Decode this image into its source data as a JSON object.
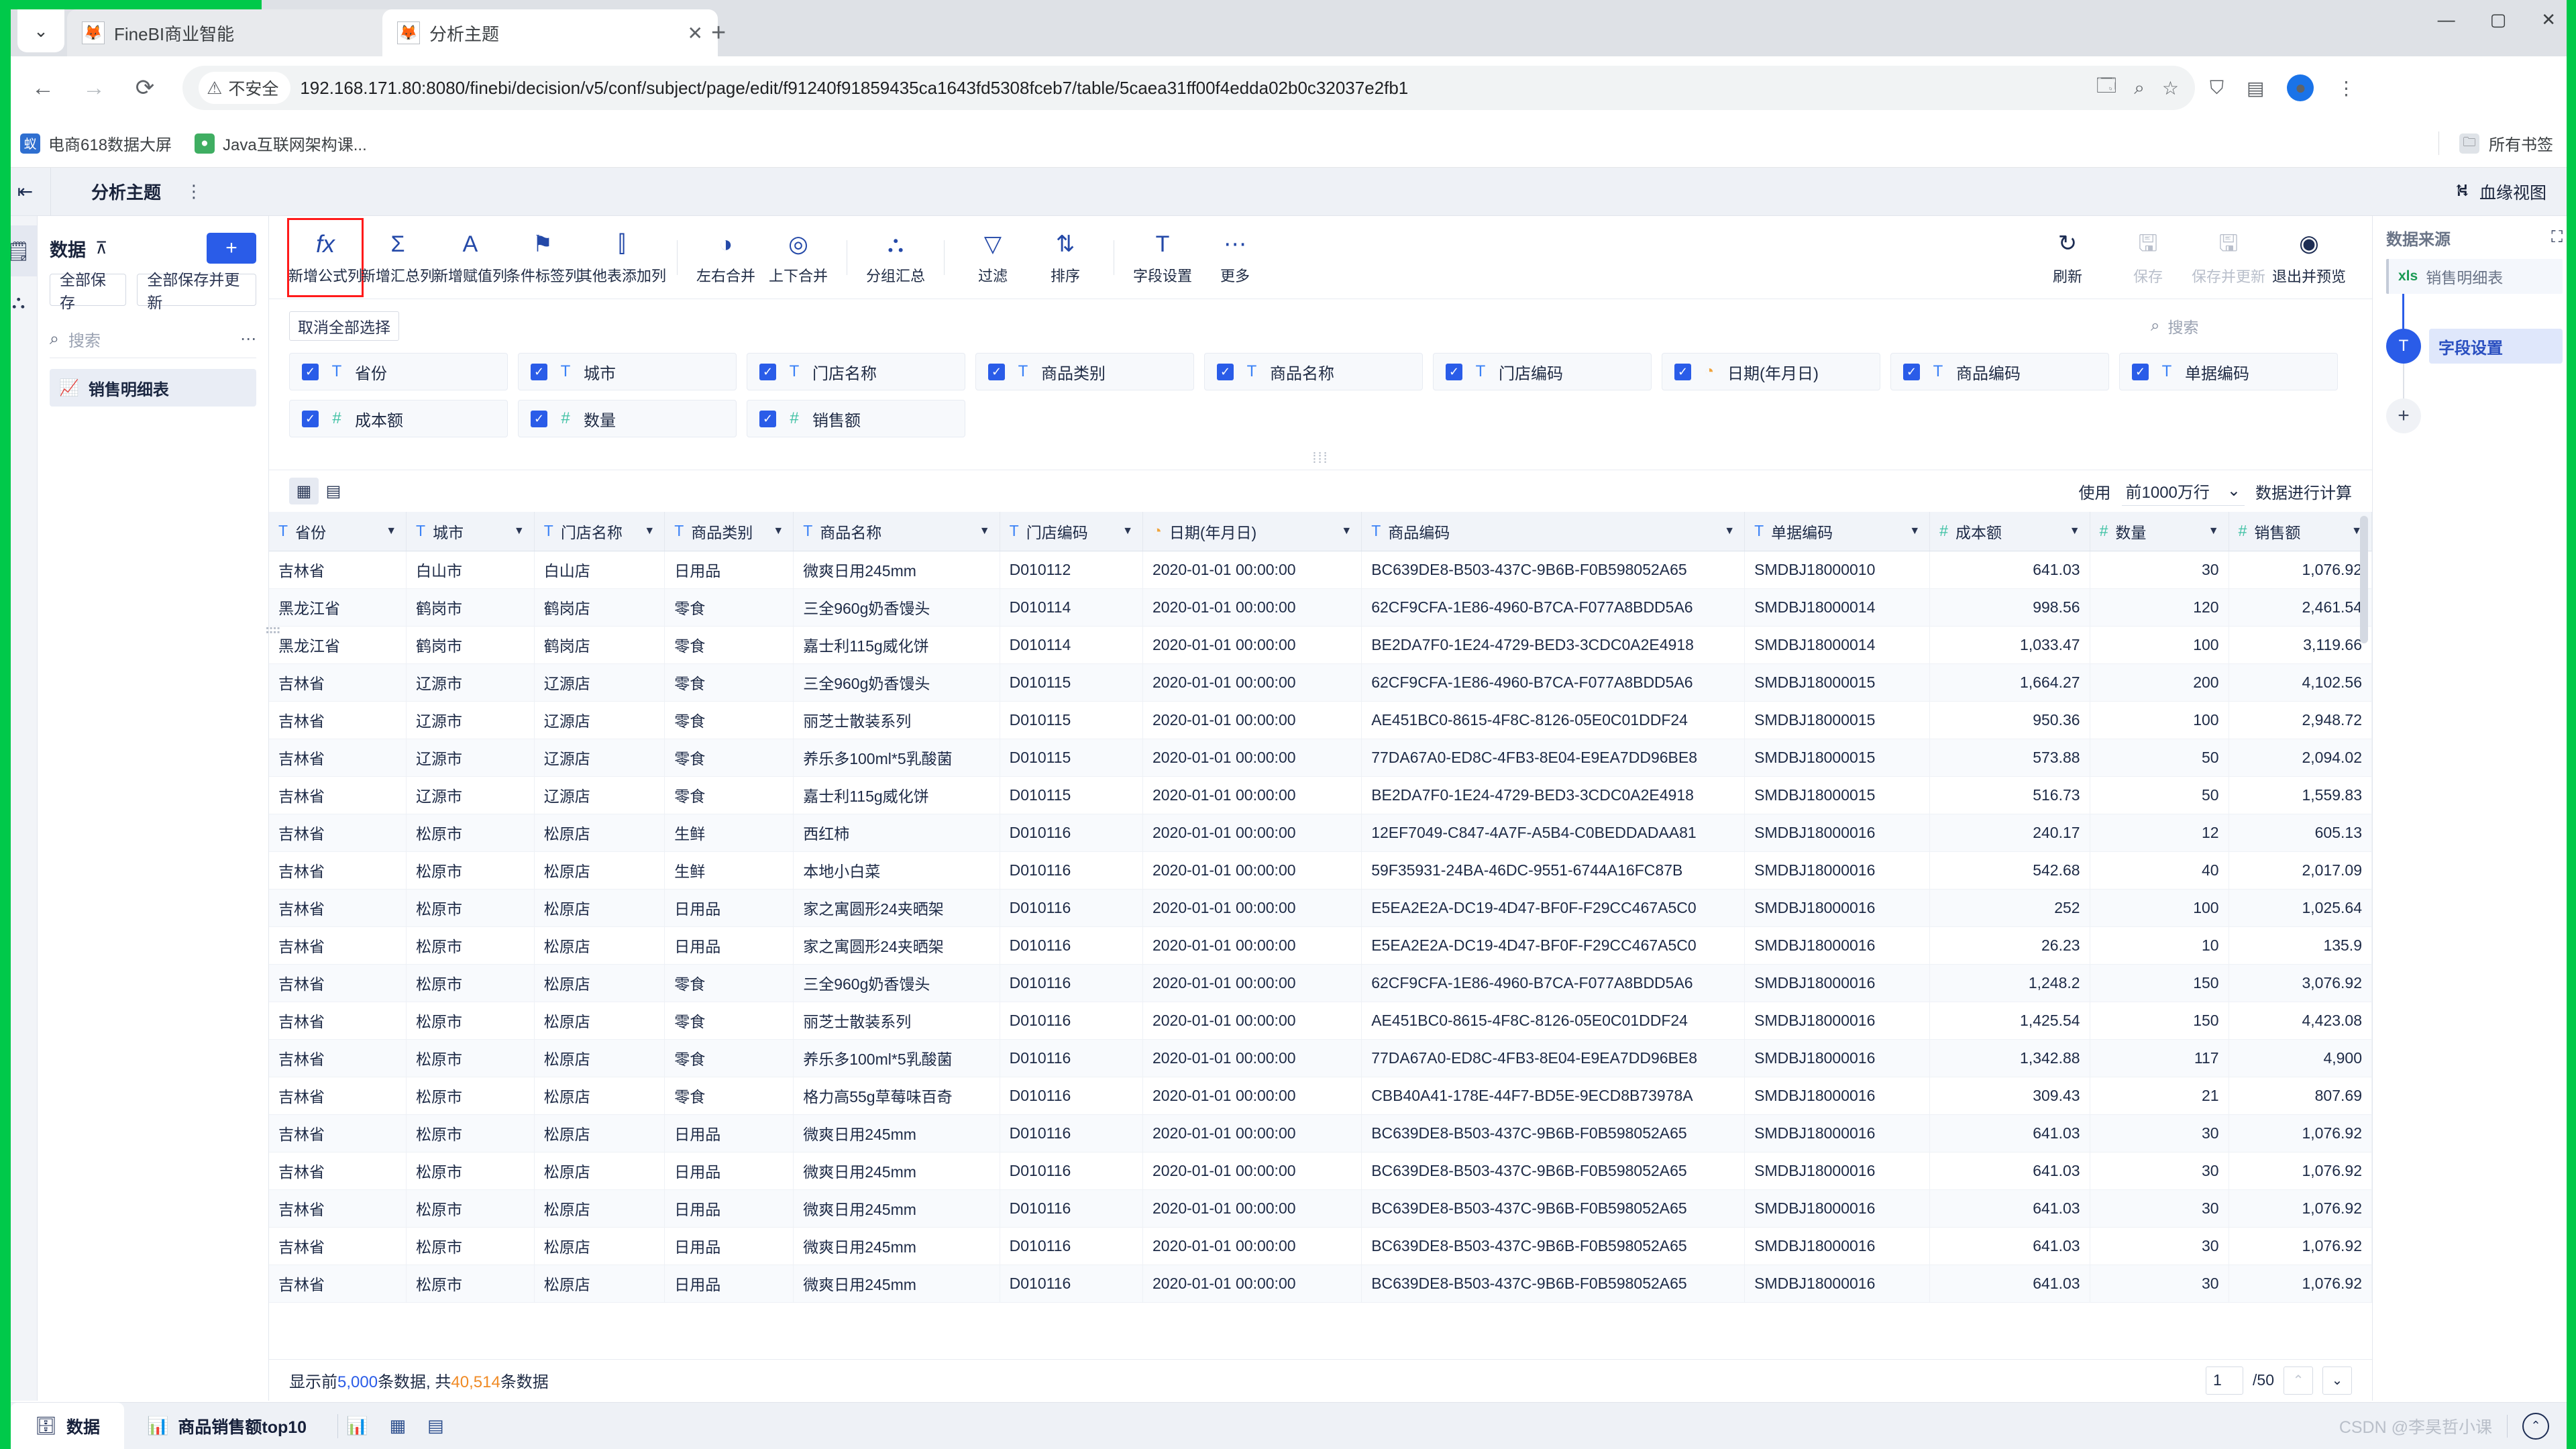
{
  "browser": {
    "tabs": [
      {
        "title": "FineBI商业智能",
        "active": false,
        "favicon": "🦊"
      },
      {
        "title": "分析主题",
        "active": true,
        "favicon": "🦊"
      }
    ],
    "new_tab_label": "+",
    "window_buttons": [
      "—",
      "▢",
      "✕"
    ],
    "nav": {
      "back": "←",
      "forward": "→",
      "reload": "⟳",
      "insecure_warning": "⚠",
      "insecure_label": "不安全",
      "url": "192.168.171.80:8080/finebi/decision/v5/conf/subject/page/edit/f91240f91859435ca1643fd5308fceb7/table/5caea31ff00f4edda02b0c32037e2fb1",
      "translate_icon": "🗔",
      "zoom_icon": "⌕",
      "star_icon": "☆",
      "extensions_icon": "⛉",
      "sidepanel_icon": "▤",
      "profile_initial": "●",
      "menu_icon": "⋮"
    },
    "bookmarks": [
      {
        "label": "电商618数据大屏",
        "color": "#2f6fd0",
        "glyph": "蚁"
      },
      {
        "label": "Java互联网架构课...",
        "color": "#3fae62",
        "glyph": "●"
      }
    ],
    "bookmarks_right": {
      "folder_icon": "🗀",
      "label": "所有书签"
    }
  },
  "app": {
    "header": {
      "back_icon": "⇤",
      "title": "分析主题",
      "more_icon": "⋮",
      "lineage_icon": "⛕",
      "lineage_label": "血缘视图"
    },
    "rail": [
      {
        "name": "analysis",
        "icon": "🗒",
        "active": true
      },
      {
        "name": "relation",
        "icon": "⛬",
        "active": false
      }
    ],
    "left_panel": {
      "title": "数据",
      "collapse_icon": "⌃",
      "add_label": "+",
      "save_all_label": "全部保存",
      "save_update_all_label": "全部保存并更新",
      "search_placeholder": "搜索",
      "search_icon": "⌕",
      "more_icon": "⋯",
      "items": [
        {
          "label": "销售明细表",
          "icon": "📈"
        }
      ]
    },
    "toolbar": {
      "items": [
        {
          "label": "新增公式列",
          "icon": "fx",
          "highlight": true
        },
        {
          "label": "新增汇总列",
          "icon": "Σ",
          "highlight": false
        },
        {
          "label": "新增赋值列",
          "icon": "A",
          "highlight": false
        },
        {
          "label": "条件标签列",
          "icon": "⚑",
          "highlight": false
        },
        {
          "label": "其他表添加列",
          "icon": "⫿",
          "highlight": false
        }
      ],
      "items2": [
        {
          "label": "左右合并",
          "icon": "◑"
        },
        {
          "label": "上下合并",
          "icon": "◎"
        }
      ],
      "items3": [
        {
          "label": "分组汇总",
          "icon": "⛬"
        }
      ],
      "items4": [
        {
          "label": "过滤",
          "icon": "▽"
        },
        {
          "label": "排序",
          "icon": "⇅"
        }
      ],
      "items5": [
        {
          "label": "字段设置",
          "icon": "T"
        }
      ],
      "items6": [
        {
          "label": "更多",
          "icon": "⋯"
        }
      ],
      "right_items": [
        {
          "label": "刷新",
          "icon": "↻",
          "disabled": false
        },
        {
          "label": "保存",
          "icon": "🖫",
          "disabled": true
        },
        {
          "label": "保存并更新",
          "icon": "🖫",
          "disabled": true
        },
        {
          "label": "退出并预览",
          "icon": "◉",
          "disabled": false
        }
      ]
    },
    "fields_area": {
      "clear_all_label": "取消全部选择",
      "search_placeholder": "搜索",
      "search_icon": "⌕",
      "chips": [
        {
          "label": "省份",
          "type": "T",
          "checked": true
        },
        {
          "label": "城市",
          "type": "T",
          "checked": true
        },
        {
          "label": "门店名称",
          "type": "T",
          "checked": true
        },
        {
          "label": "商品类别",
          "type": "T",
          "checked": true
        },
        {
          "label": "商品名称",
          "type": "T",
          "checked": true
        },
        {
          "label": "门店编码",
          "type": "T",
          "checked": true
        },
        {
          "label": "日期(年月日)",
          "type": "D",
          "checked": true
        },
        {
          "label": "商品编码",
          "type": "T",
          "checked": true
        },
        {
          "label": "单据编码",
          "type": "T",
          "checked": true
        },
        {
          "label": "成本额",
          "type": "N",
          "checked": true
        },
        {
          "label": "数量",
          "type": "N",
          "checked": true
        },
        {
          "label": "销售额",
          "type": "N",
          "checked": true
        }
      ]
    },
    "table_toolbar": {
      "grid_icon": "▦",
      "card_icon": "▤",
      "use_label": "使用",
      "rows_option": "前1000万行",
      "caret": "⌄",
      "compute_label": "数据进行计算"
    },
    "table": {
      "columns": [
        {
          "label": "省份",
          "type": "T",
          "align": "left",
          "width": "163"
        },
        {
          "label": "城市",
          "type": "T",
          "align": "left",
          "width": "152"
        },
        {
          "label": "门店名称",
          "type": "T",
          "align": "left",
          "width": "155"
        },
        {
          "label": "商品类别",
          "type": "T",
          "align": "left",
          "width": "153"
        },
        {
          "label": "商品名称",
          "type": "T",
          "align": "left",
          "width": "245"
        },
        {
          "label": "门店编码",
          "type": "T",
          "align": "left",
          "width": "170"
        },
        {
          "label": "日期(年月日)",
          "type": "D",
          "align": "left",
          "width": "260"
        },
        {
          "label": "商品编码",
          "type": "T",
          "align": "left",
          "width": "455"
        },
        {
          "label": "单据编码",
          "type": "T",
          "align": "left",
          "width": "220"
        },
        {
          "label": "成本额",
          "type": "N",
          "align": "right",
          "width": "190"
        },
        {
          "label": "数量",
          "type": "N",
          "align": "right",
          "width": "165"
        },
        {
          "label": "销售额",
          "type": "N",
          "align": "right",
          "width": "170"
        }
      ],
      "rows": [
        [
          "吉林省",
          "白山市",
          "白山店",
          "日用品",
          "微爽日用245mm",
          "D010112",
          "2020-01-01 00:00:00",
          "BC639DE8-B503-437C-9B6B-F0B598052A65",
          "SMDBJ18000010",
          "641.03",
          "30",
          "1,076.92"
        ],
        [
          "黑龙江省",
          "鹤岗市",
          "鹤岗店",
          "零食",
          "三全960g奶香馒头",
          "D010114",
          "2020-01-01 00:00:00",
          "62CF9CFA-1E86-4960-B7CA-F077A8BDD5A6",
          "SMDBJ18000014",
          "998.56",
          "120",
          "2,461.54"
        ],
        [
          "黑龙江省",
          "鹤岗市",
          "鹤岗店",
          "零食",
          "嘉士利115g威化饼",
          "D010114",
          "2020-01-01 00:00:00",
          "BE2DA7F0-1E24-4729-BED3-3CDC0A2E4918",
          "SMDBJ18000014",
          "1,033.47",
          "100",
          "3,119.66"
        ],
        [
          "吉林省",
          "辽源市",
          "辽源店",
          "零食",
          "三全960g奶香馒头",
          "D010115",
          "2020-01-01 00:00:00",
          "62CF9CFA-1E86-4960-B7CA-F077A8BDD5A6",
          "SMDBJ18000015",
          "1,664.27",
          "200",
          "4,102.56"
        ],
        [
          "吉林省",
          "辽源市",
          "辽源店",
          "零食",
          "丽芝士散装系列",
          "D010115",
          "2020-01-01 00:00:00",
          "AE451BC0-8615-4F8C-8126-05E0C01DDF24",
          "SMDBJ18000015",
          "950.36",
          "100",
          "2,948.72"
        ],
        [
          "吉林省",
          "辽源市",
          "辽源店",
          "零食",
          "养乐多100ml*5乳酸菌",
          "D010115",
          "2020-01-01 00:00:00",
          "77DA67A0-ED8C-4FB3-8E04-E9EA7DD96BE8",
          "SMDBJ18000015",
          "573.88",
          "50",
          "2,094.02"
        ],
        [
          "吉林省",
          "辽源市",
          "辽源店",
          "零食",
          "嘉士利115g威化饼",
          "D010115",
          "2020-01-01 00:00:00",
          "BE2DA7F0-1E24-4729-BED3-3CDC0A2E4918",
          "SMDBJ18000015",
          "516.73",
          "50",
          "1,559.83"
        ],
        [
          "吉林省",
          "松原市",
          "松原店",
          "生鲜",
          "西红柿",
          "D010116",
          "2020-01-01 00:00:00",
          "12EF7049-C847-4A7F-A5B4-C0BEDDADAA81",
          "SMDBJ18000016",
          "240.17",
          "12",
          "605.13"
        ],
        [
          "吉林省",
          "松原市",
          "松原店",
          "生鲜",
          "本地小白菜",
          "D010116",
          "2020-01-01 00:00:00",
          "59F35931-24BA-46DC-9551-6744A16FC87B",
          "SMDBJ18000016",
          "542.68",
          "40",
          "2,017.09"
        ],
        [
          "吉林省",
          "松原市",
          "松原店",
          "日用品",
          "家之寓圆形24夹晒架",
          "D010116",
          "2020-01-01 00:00:00",
          "E5EA2E2A-DC19-4D47-BF0F-F29CC467A5C0",
          "SMDBJ18000016",
          "252",
          "100",
          "1,025.64"
        ],
        [
          "吉林省",
          "松原市",
          "松原店",
          "日用品",
          "家之寓圆形24夹晒架",
          "D010116",
          "2020-01-01 00:00:00",
          "E5EA2E2A-DC19-4D47-BF0F-F29CC467A5C0",
          "SMDBJ18000016",
          "26.23",
          "10",
          "135.9"
        ],
        [
          "吉林省",
          "松原市",
          "松原店",
          "零食",
          "三全960g奶香馒头",
          "D010116",
          "2020-01-01 00:00:00",
          "62CF9CFA-1E86-4960-B7CA-F077A8BDD5A6",
          "SMDBJ18000016",
          "1,248.2",
          "150",
          "3,076.92"
        ],
        [
          "吉林省",
          "松原市",
          "松原店",
          "零食",
          "丽芝士散装系列",
          "D010116",
          "2020-01-01 00:00:00",
          "AE451BC0-8615-4F8C-8126-05E0C01DDF24",
          "SMDBJ18000016",
          "1,425.54",
          "150",
          "4,423.08"
        ],
        [
          "吉林省",
          "松原市",
          "松原店",
          "零食",
          "养乐多100ml*5乳酸菌",
          "D010116",
          "2020-01-01 00:00:00",
          "77DA67A0-ED8C-4FB3-8E04-E9EA7DD96BE8",
          "SMDBJ18000016",
          "1,342.88",
          "117",
          "4,900"
        ],
        [
          "吉林省",
          "松原市",
          "松原店",
          "零食",
          "格力高55g草莓味百奇",
          "D010116",
          "2020-01-01 00:00:00",
          "CBB40A41-178E-44F7-BD5E-9ECD8B73978A",
          "SMDBJ18000016",
          "309.43",
          "21",
          "807.69"
        ],
        [
          "吉林省",
          "松原市",
          "松原店",
          "日用品",
          "微爽日用245mm",
          "D010116",
          "2020-01-01 00:00:00",
          "BC639DE8-B503-437C-9B6B-F0B598052A65",
          "SMDBJ18000016",
          "641.03",
          "30",
          "1,076.92"
        ],
        [
          "吉林省",
          "松原市",
          "松原店",
          "日用品",
          "微爽日用245mm",
          "D010116",
          "2020-01-01 00:00:00",
          "BC639DE8-B503-437C-9B6B-F0B598052A65",
          "SMDBJ18000016",
          "641.03",
          "30",
          "1,076.92"
        ],
        [
          "吉林省",
          "松原市",
          "松原店",
          "日用品",
          "微爽日用245mm",
          "D010116",
          "2020-01-01 00:00:00",
          "BC639DE8-B503-437C-9B6B-F0B598052A65",
          "SMDBJ18000016",
          "641.03",
          "30",
          "1,076.92"
        ],
        [
          "吉林省",
          "松原市",
          "松原店",
          "日用品",
          "微爽日用245mm",
          "D010116",
          "2020-01-01 00:00:00",
          "BC639DE8-B503-437C-9B6B-F0B598052A65",
          "SMDBJ18000016",
          "641.03",
          "30",
          "1,076.92"
        ],
        [
          "吉林省",
          "松原市",
          "松原店",
          "日用品",
          "微爽日用245mm",
          "D010116",
          "2020-01-01 00:00:00",
          "BC639DE8-B503-437C-9B6B-F0B598052A65",
          "SMDBJ18000016",
          "641.03",
          "30",
          "1,076.92"
        ]
      ]
    },
    "table_footer": {
      "prefix": "显示前",
      "shown_count": "5,000",
      "middle": "条数据, 共",
      "total_count": "40,514",
      "suffix": "条数据",
      "page_value": "1",
      "page_total": "/50",
      "prev_icon": "⌃",
      "next_icon": "⌄"
    },
    "right_panel": {
      "title": "数据来源",
      "expand_icon": "⛶",
      "source": {
        "badge": "xls",
        "label": "销售明细表"
      },
      "step": {
        "icon": "T",
        "label": "字段设置"
      },
      "add_icon": "+"
    },
    "status_bar": {
      "data_tab": {
        "icon": "🗄",
        "label": "数据"
      },
      "chart_tab": {
        "icon": "📊",
        "label": "商品销售额top10"
      },
      "add_icons": [
        "📊",
        "▦",
        "▤"
      ],
      "watermark": "CSDN @李昊哲小课",
      "collapse_icon": "⌃"
    }
  }
}
